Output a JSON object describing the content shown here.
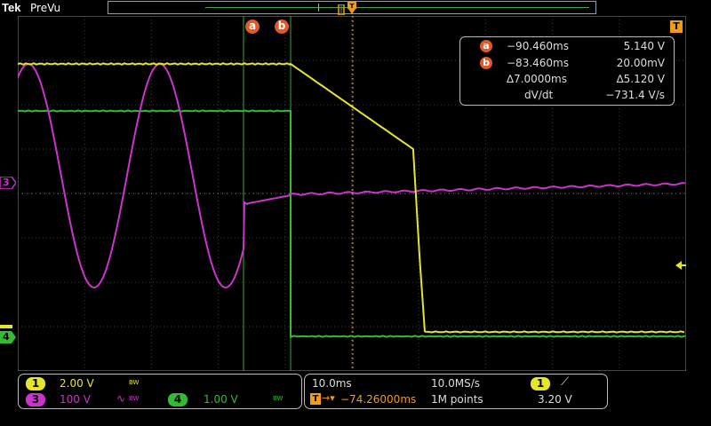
{
  "header": {
    "brand": "Tek",
    "mode": "PreVu",
    "trigger_icon": "trigger-marker-icon",
    "t_marker": "T"
  },
  "channels": {
    "ch1": {
      "number": "1",
      "color": "#e5e52a",
      "scale": "2.00 V",
      "bw": "BW"
    },
    "ch3": {
      "number": "3",
      "color": "#cc33cc",
      "scale": "100 V",
      "bw": "BW",
      "filter_glyph": "∿"
    },
    "ch4": {
      "number": "4",
      "color": "#33bb33",
      "scale": "1.00 V",
      "bw": "BW"
    }
  },
  "cursors": {
    "a_label": "a",
    "b_label": "b",
    "a_time": "−90.460ms",
    "a_value": "5.140 V",
    "b_time": "−83.460ms",
    "b_value": "20.00mV",
    "delta_time": "∆7.0000ms",
    "delta_value": "∆5.120 V",
    "dvdt_label": "dV/dt",
    "dvdt_value": "−731.4 V/s"
  },
  "horizontal": {
    "time_per_div": "10.0ms",
    "sample_rate": "10.0MS/s",
    "trigger_position": "−74.26000ms",
    "record_length": "1M points"
  },
  "trigger": {
    "source": "1",
    "slope_glyph": "⟋",
    "level": "3.20 V"
  },
  "side_markers": {
    "ch3": "3",
    "ch4": "4"
  }
}
